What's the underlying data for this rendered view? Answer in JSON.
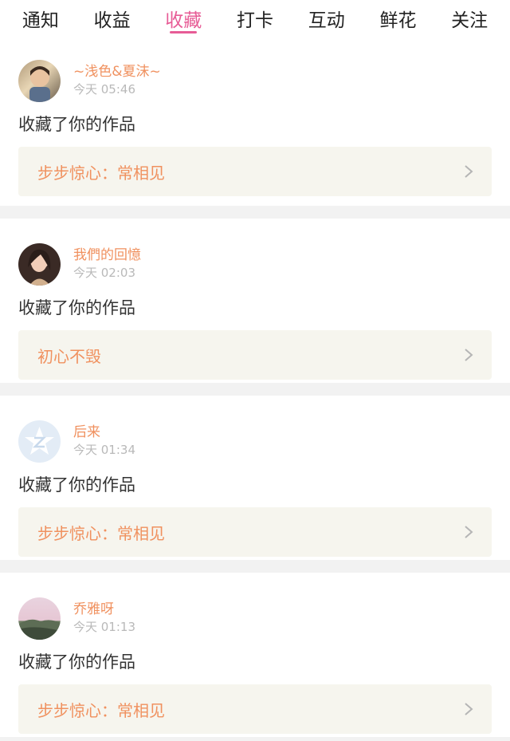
{
  "tabs": [
    {
      "label": "通知",
      "active": false
    },
    {
      "label": "收益",
      "active": false
    },
    {
      "label": "收藏",
      "active": true
    },
    {
      "label": "打卡",
      "active": false
    },
    {
      "label": "互动",
      "active": false
    },
    {
      "label": "鲜花",
      "active": false
    },
    {
      "label": "关注",
      "active": false
    }
  ],
  "items": [
    {
      "name": "~浅色&夏沫~",
      "time": "今天 05:46",
      "action": "收藏了你的作品",
      "work": "步步惊心：常相见",
      "avatar": "child-photo-avatar"
    },
    {
      "name": "我們的回憶",
      "time": "今天 02:03",
      "action": "收藏了你的作品",
      "work": "初心不毁",
      "avatar": "woman-photo-avatar"
    },
    {
      "name": "后来",
      "time": "今天 01:34",
      "action": "收藏了你的作品",
      "work": "步步惊心：常相见",
      "avatar": "qq-star-default-avatar"
    },
    {
      "name": "乔雅呀",
      "time": "今天 01:13",
      "action": "收藏了你的作品",
      "work": "步步惊心：常相见",
      "avatar": "landscape-photo-avatar"
    }
  ],
  "colors": {
    "accent": "#e75c96",
    "name": "#f0915f",
    "time": "#b9b9b9",
    "work_bg": "#f6f5ee"
  },
  "icons": {
    "chevron": "chevron-right-icon"
  }
}
